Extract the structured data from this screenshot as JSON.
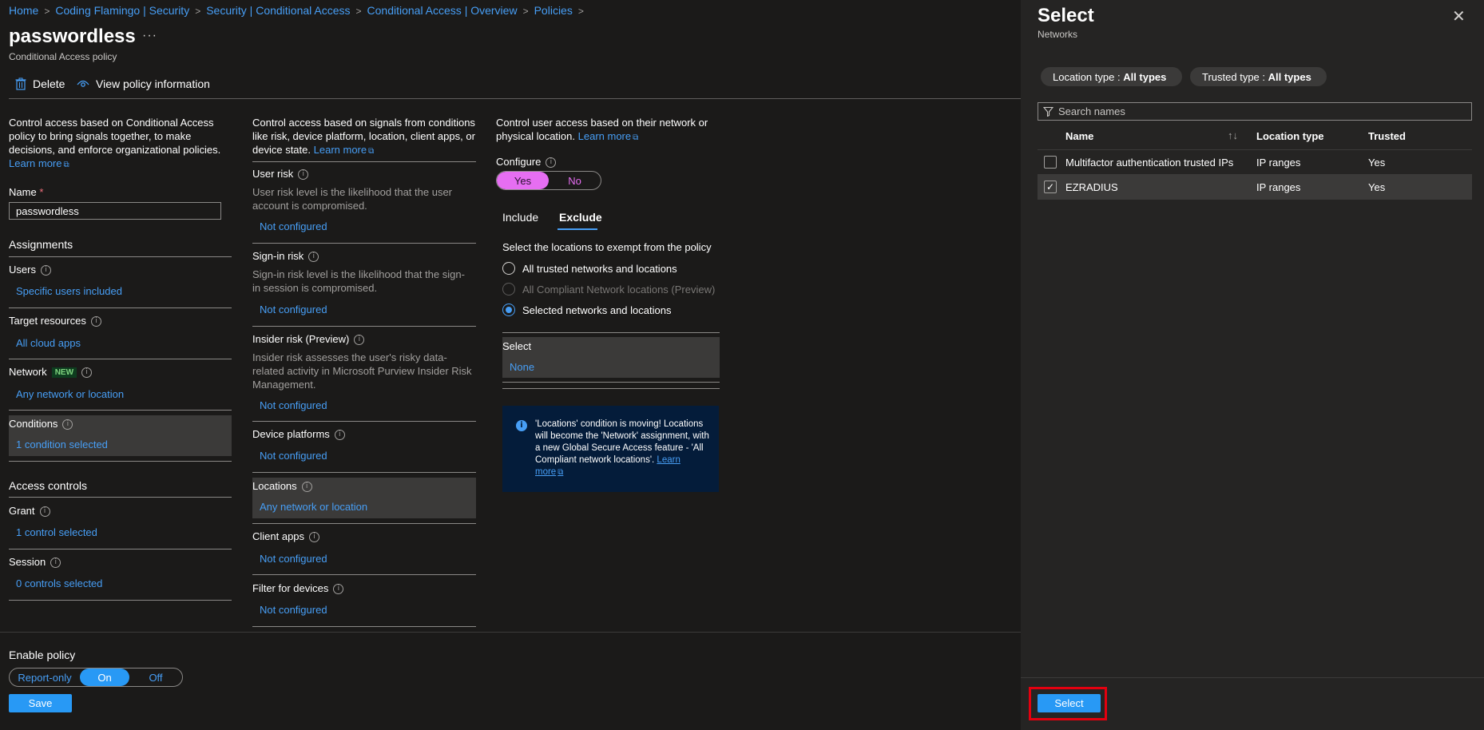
{
  "breadcrumb": [
    "Home",
    "Coding Flamingo | Security",
    "Security | Conditional Access",
    "Conditional Access | Overview",
    "Policies"
  ],
  "page": {
    "title": "passwordless",
    "more_icon": "ellipsis-icon",
    "subtitle": "Conditional Access policy"
  },
  "toolbar": {
    "delete_label": "Delete",
    "view_info_label": "View policy information"
  },
  "left": {
    "description": "Control access based on Conditional Access policy to bring signals together, to make decisions, and enforce organizational policies.",
    "learn_more": "Learn more",
    "name_label": "Name",
    "name_required": "*",
    "name_value": "passwordless",
    "assignments_heading": "Assignments",
    "users_label": "Users",
    "users_value": "Specific users included",
    "target_label": "Target resources",
    "target_value": "All cloud apps",
    "network_label": "Network",
    "network_badge": "NEW",
    "network_value": "Any network or location",
    "conditions_label": "Conditions",
    "conditions_value": "1 condition selected",
    "access_heading": "Access controls",
    "grant_label": "Grant",
    "grant_value": "1 control selected",
    "session_label": "Session",
    "session_value": "0 controls selected"
  },
  "middle": {
    "description": "Control access based on signals from conditions like risk, device platform, location, client apps, or device state.",
    "learn_more": "Learn more",
    "user_risk_label": "User risk",
    "user_risk_desc": "User risk level is the likelihood that the user account is compromised.",
    "user_risk_value": "Not configured",
    "signin_risk_label": "Sign-in risk",
    "signin_risk_desc": "Sign-in risk level is the likelihood that the sign-in session is compromised.",
    "signin_risk_value": "Not configured",
    "insider_label": "Insider risk (Preview)",
    "insider_desc": "Insider risk assesses the user's risky data-related activity in Microsoft Purview Insider Risk Management.",
    "insider_value": "Not configured",
    "device_label": "Device platforms",
    "device_value": "Not configured",
    "locations_label": "Locations",
    "locations_value": "Any network or location",
    "client_label": "Client apps",
    "client_value": "Not configured",
    "filter_label": "Filter for devices",
    "filter_value": "Not configured"
  },
  "right": {
    "description": "Control user access based on their network or physical location.",
    "learn_more": "Learn more",
    "configure_label": "Configure",
    "yes_label": "Yes",
    "no_label": "No",
    "tab_include": "Include",
    "tab_exclude": "Exclude",
    "exempt_label": "Select the locations to exempt from the policy",
    "radio_all_trusted": "All trusted networks and locations",
    "radio_compliant": "All Compliant Network locations (Preview)",
    "radio_selected": "Selected networks and locations",
    "select_label": "Select",
    "select_value": "None",
    "info_text": "'Locations' condition is moving! Locations will become the 'Network' assignment, with a new Global Secure Access feature - 'All Compliant network locations'.",
    "info_link": "Learn more"
  },
  "bottom": {
    "enable_label": "Enable policy",
    "report_only": "Report-only",
    "on": "On",
    "off": "Off",
    "save": "Save"
  },
  "panel": {
    "title": "Select",
    "subtitle": "Networks",
    "filter_location_key": "Location type : ",
    "filter_location_val": "All types",
    "filter_trusted_key": "Trusted type : ",
    "filter_trusted_val": "All types",
    "search_placeholder": "Search names",
    "col_name": "Name",
    "col_location_type": "Location type",
    "col_trusted": "Trusted",
    "rows": [
      {
        "name": "Multifactor authentication trusted IPs",
        "type": "IP ranges",
        "trusted": "Yes",
        "checked": false
      },
      {
        "name": "EZRADIUS",
        "type": "IP ranges",
        "trusted": "Yes",
        "checked": true
      }
    ],
    "select_button": "Select"
  },
  "colors": {
    "accent": "#479ef5",
    "primary_button": "#2899f5",
    "toggle_pink": "#e66ef2",
    "highlight_red": "#e3000f",
    "background": "#1b1a19",
    "panel_background": "#252423"
  }
}
